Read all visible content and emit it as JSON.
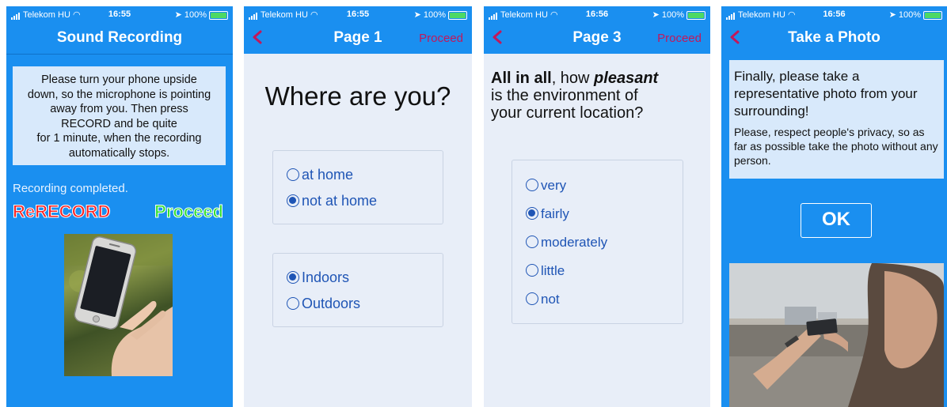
{
  "status": [
    {
      "carrier": "Telekom HU",
      "time": "16:55",
      "battery": "100%"
    },
    {
      "carrier": "Telekom HU",
      "time": "16:55",
      "battery": "100%"
    },
    {
      "carrier": "Telekom HU",
      "time": "16:56",
      "battery": "100%"
    },
    {
      "carrier": "Telekom HU",
      "time": "16:56",
      "battery": "100%"
    }
  ],
  "screen1": {
    "title": "Sound Recording",
    "instruction_lines": [
      "Please turn your phone upside",
      "down, so the microphone is pointing",
      "away from you. Then press",
      "RECORD and be quite",
      "for 1 minute, when the recording",
      "automatically stops."
    ],
    "recording_status": "Recording completed.",
    "rerecord_label": "ReRECORD",
    "proceed_label": "Proceed"
  },
  "screen2": {
    "title": "Page 1",
    "proceed_label": "Proceed",
    "question": "Where are you?",
    "group1": [
      {
        "label": "at home",
        "checked": false
      },
      {
        "label": "not at home",
        "checked": true
      }
    ],
    "group2": [
      {
        "label": "Indoors",
        "checked": true
      },
      {
        "label": "Outdoors",
        "checked": false
      }
    ]
  },
  "screen3": {
    "title": "Page 3",
    "proceed_label": "Proceed",
    "question": {
      "p1": "All in all",
      "p2": ", how ",
      "p3": "pleasant",
      "line2": "is the environment of",
      "line3": "your current location?"
    },
    "options": [
      {
        "label": "very",
        "checked": false
      },
      {
        "label": "fairly",
        "checked": true
      },
      {
        "label": "moderately",
        "checked": false
      },
      {
        "label": "little",
        "checked": false
      },
      {
        "label": "not",
        "checked": false
      }
    ]
  },
  "screen4": {
    "title": "Take a Photo",
    "instruction_main": "Finally, please take a representative photo from your surrounding!",
    "instruction_sub": "Please, respect people's privacy, so as far as possible take the photo without any person.",
    "ok_label": "OK"
  },
  "colors": {
    "header_blue": "#1a8ff0",
    "radio_blue": "#1f55b5",
    "proceed_pink": "#c2185b",
    "rerecord_red": "#ff2222",
    "proceed_green": "#2ee02e",
    "instruction_bg": "#d8e9fb"
  }
}
